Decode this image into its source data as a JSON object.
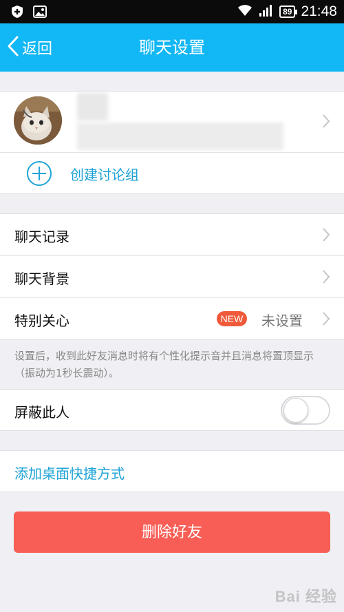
{
  "status_bar": {
    "time": "21:48",
    "battery": "89",
    "icons": [
      "shield-icon",
      "image-icon",
      "wifi-icon",
      "signal-icon",
      "battery-icon"
    ]
  },
  "header": {
    "back_label": "返回",
    "title": "聊天设置",
    "background": "#12b7f5"
  },
  "profile": {
    "avatar_icon": "cat-avatar",
    "name": "",
    "chevron": "chevron-right-icon"
  },
  "create_group": {
    "label": "创建讨论组",
    "icon": "plus-circle-icon"
  },
  "menu": {
    "chat_history": "聊天记录",
    "chat_background": "聊天背景",
    "special_care": "特别关心",
    "special_care_badge": "NEW",
    "special_care_value": "未设置"
  },
  "hint": "设置后，收到此好友消息时将有个性化提示音并且消息将置顶显示（振动为1秒长震动）。",
  "block": {
    "label": "屏蔽此人",
    "enabled": false
  },
  "shortcut": {
    "label": "添加桌面快捷方式"
  },
  "delete_button": {
    "label": "删除好友",
    "color": "#f85e55"
  },
  "watermark": "Bai 经验"
}
